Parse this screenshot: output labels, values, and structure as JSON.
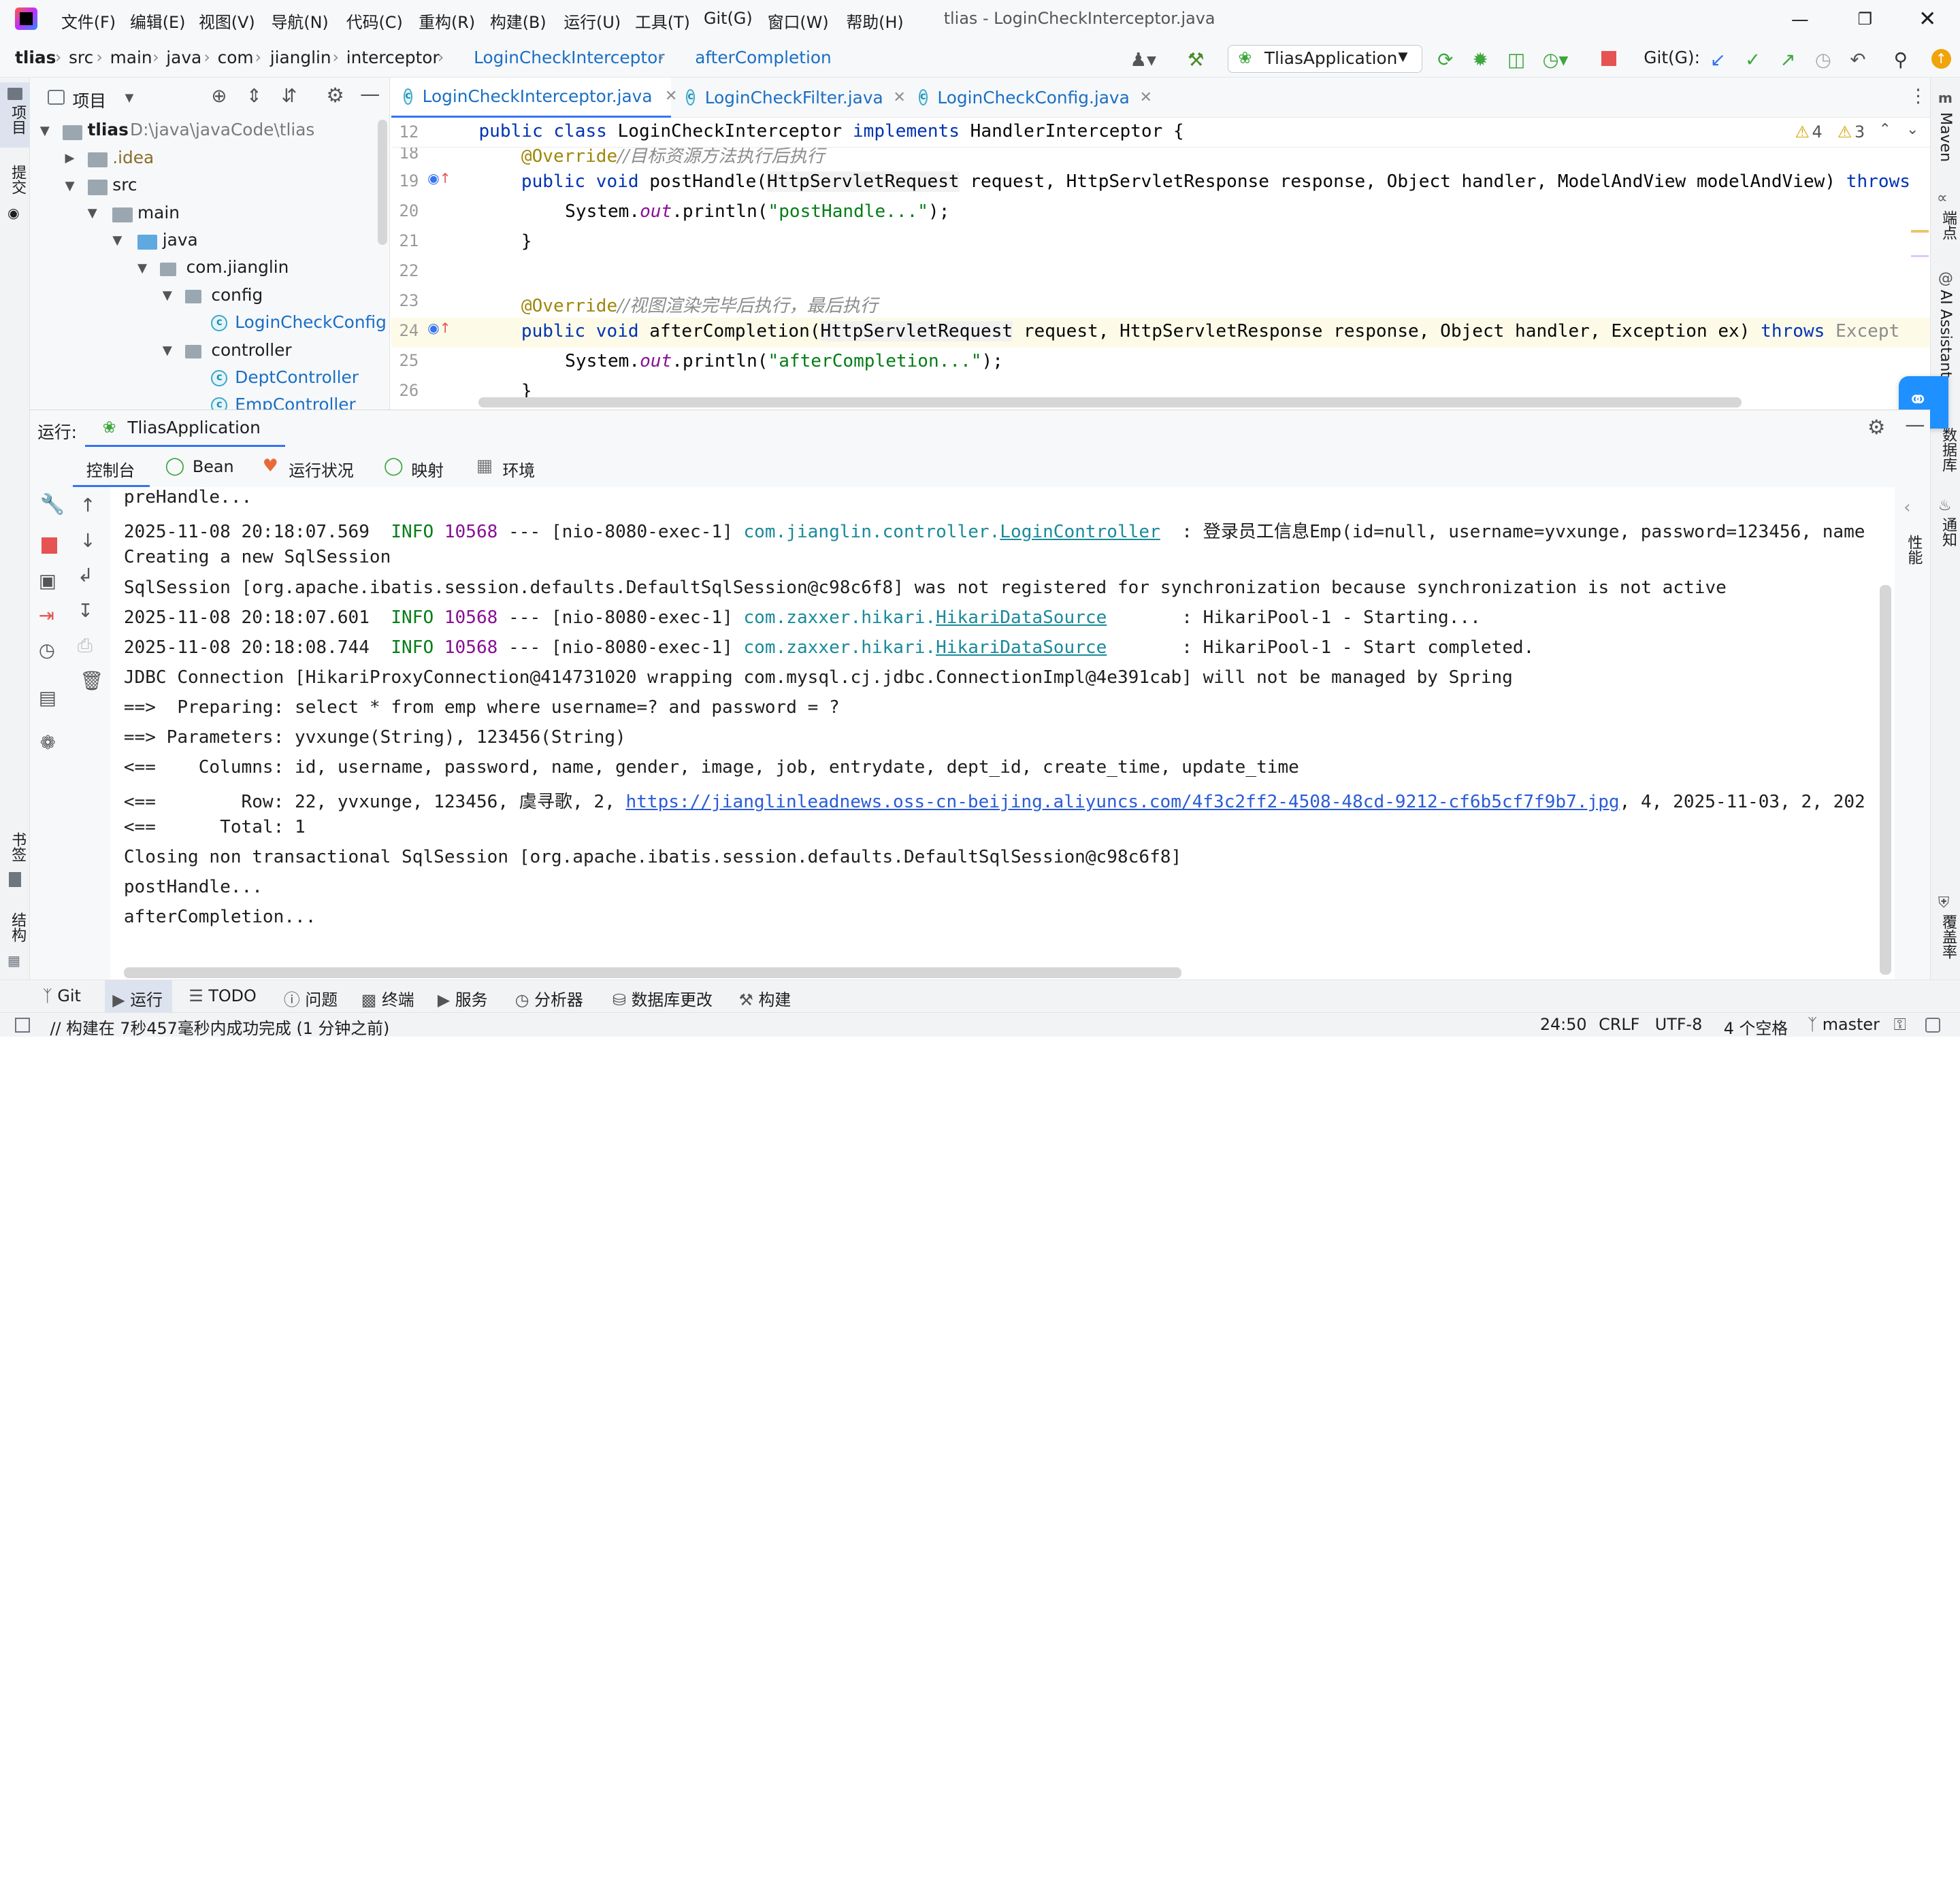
{
  "window": {
    "title": "tlias - LoginCheckInterceptor.java",
    "menu": [
      "文件(F)",
      "编辑(E)",
      "视图(V)",
      "导航(N)",
      "代码(C)",
      "重构(R)",
      "构建(B)",
      "运行(U)",
      "工具(T)",
      "Git(G)",
      "窗口(W)",
      "帮助(H)"
    ]
  },
  "breadcrumb": [
    "tlias",
    "src",
    "main",
    "java",
    "com",
    "jianglin",
    "interceptor",
    "LoginCheckInterceptor",
    "afterCompletion"
  ],
  "toolbar": {
    "run_config": "TliasApplication",
    "git_label": "Git(G):"
  },
  "project_panel": {
    "title": "项目",
    "root_name": "tlias",
    "root_path": "D:\\java\\javaCode\\tlias",
    "items": [
      ".idea",
      "src",
      "main",
      "java",
      "com.jianglin",
      "config",
      "LoginCheckConfig",
      "controller",
      "DeptController",
      "EmpController"
    ]
  },
  "left_stripe": {
    "project": "项目",
    "commit": "提交",
    "bookmarks": "书签",
    "structure": "结构"
  },
  "right_stripe": {
    "maven": "Maven",
    "endpoints": "端点",
    "ai": "AI Assistant",
    "database": "数据库",
    "notifications": "通知",
    "coverage": "覆盖率",
    "perf": "性能"
  },
  "editor": {
    "tabs": [
      "LoginCheckInterceptor.java",
      "LoginCheckFilter.java",
      "LoginCheckConfig.java"
    ],
    "warnings": "4",
    "weak_warnings": "3",
    "line_numbers": [
      "12",
      "18",
      "19",
      "20",
      "21",
      "22",
      "23",
      "24",
      "25",
      "26"
    ],
    "sticky_line": "public class LoginCheckInterceptor implements HandlerInterceptor {",
    "comment_18": "//目标资源方法执行后执行",
    "comment_23": "//视图渲染完毕后执行，最后执行",
    "str_post": "\"postHandle...\"",
    "str_after": "\"afterCompletion...\""
  },
  "run": {
    "label": "运行:",
    "config": "TliasApplication",
    "tabs": [
      "控制台",
      "Bean",
      "运行状况",
      "映射",
      "环境"
    ]
  },
  "console": {
    "lines": [
      "preHandle...",
      "2025-11-08 20:18:07.569  INFO 10568 --- [nio-8080-exec-1] com.jianglin.controller.LoginController  : 登录员工信息Emp(id=null, username=yvxunge, password=123456, name",
      "Creating a new SqlSession",
      "SqlSession [org.apache.ibatis.session.defaults.DefaultSqlSession@c98c6f8] was not registered for synchronization because synchronization is not active",
      "2025-11-08 20:18:07.601  INFO 10568 --- [nio-8080-exec-1] com.zaxxer.hikari.HikariDataSource       : HikariPool-1 - Starting...",
      "2025-11-08 20:18:08.744  INFO 10568 --- [nio-8080-exec-1] com.zaxxer.hikari.HikariDataSource       : HikariPool-1 - Start completed.",
      "JDBC Connection [HikariProxyConnection@414731020 wrapping com.mysql.cj.jdbc.ConnectionImpl@4e391cab] will not be managed by Spring",
      "==>  Preparing: select * from emp where username=? and password = ?",
      "==> Parameters: yvxunge(String), 123456(String)",
      "<==    Columns: id, username, password, name, gender, image, job, entrydate, dept_id, create_time, update_time",
      "<==        Row: 22, yvxunge, 123456, 虞寻歌, 2, https://jianglinleadnews.oss-cn-beijing.aliyuncs.com/4f3c2ff2-4508-48cd-9212-cf6b5cf7f9b7.jpg, 4, 2025-11-03, 2, 202",
      "<==      Total: 1",
      "Closing non transactional SqlSession [org.apache.ibatis.session.defaults.DefaultSqlSession@c98c6f8]",
      "postHandle...",
      "afterCompletion..."
    ]
  },
  "bottom_tools": [
    "Git",
    "运行",
    "TODO",
    "问题",
    "终端",
    "服务",
    "分析器",
    "数据库更改",
    "构建"
  ],
  "status": {
    "message": "构建在 7秒457毫秒内成功完成 (1 分钟之前)",
    "position": "24:50",
    "line_sep": "CRLF",
    "encoding": "UTF-8",
    "indent": "4 个空格",
    "branch": "master"
  },
  "colors": {
    "accent": "#3574f0",
    "keyword": "#0033b3",
    "string": "#067d17",
    "annotation": "#9e880d"
  }
}
